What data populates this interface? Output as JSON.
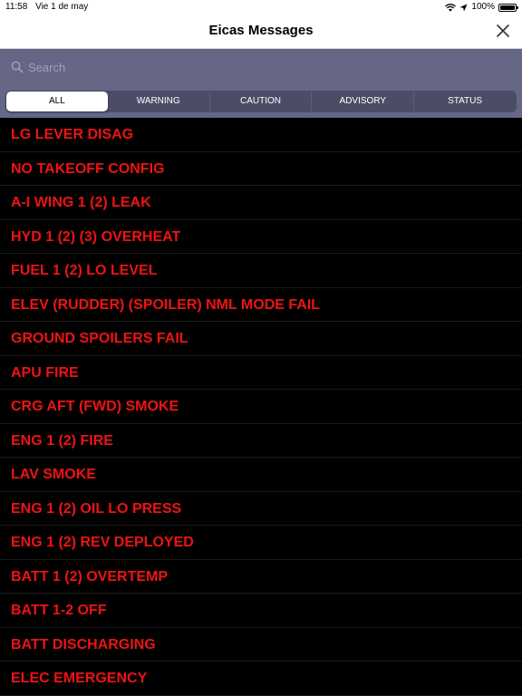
{
  "status_bar": {
    "time": "11:58",
    "date": "Vie 1 de may",
    "battery": "100%"
  },
  "header": {
    "title": "Eicas Messages"
  },
  "search": {
    "placeholder": "Search",
    "value": ""
  },
  "filters": {
    "selected": "ALL",
    "tabs": [
      {
        "label": "ALL"
      },
      {
        "label": "WARNING"
      },
      {
        "label": "CAUTION"
      },
      {
        "label": "ADVISORY"
      },
      {
        "label": "STATUS"
      }
    ]
  },
  "colors": {
    "warning_text": "#ee1313",
    "filter_bar": "#656785",
    "background": "#000000"
  },
  "icons": [
    "wifi-icon",
    "location-icon",
    "battery-icon",
    "close-icon",
    "search-icon"
  ],
  "messages": [
    {
      "text": "LG LEVER DISAG"
    },
    {
      "text": "NO TAKEOFF CONFIG"
    },
    {
      "text": "A-I WING 1 (2) LEAK"
    },
    {
      "text": "HYD 1 (2) (3) OVERHEAT"
    },
    {
      "text": "FUEL 1 (2) LO LEVEL"
    },
    {
      "text": "ELEV (RUDDER) (SPOILER) NML MODE FAIL"
    },
    {
      "text": "GROUND SPOILERS FAIL"
    },
    {
      "text": "APU FIRE"
    },
    {
      "text": "CRG AFT (FWD) SMOKE"
    },
    {
      "text": "ENG 1 (2) FIRE"
    },
    {
      "text": "LAV SMOKE"
    },
    {
      "text": "ENG 1 (2) OIL LO PRESS"
    },
    {
      "text": "ENG 1 (2) REV DEPLOYED"
    },
    {
      "text": "BATT 1 (2) OVERTEMP"
    },
    {
      "text": "BATT 1-2 OFF"
    },
    {
      "text": "BATT DISCHARGING"
    },
    {
      "text": "ELEC EMERGENCY"
    }
  ]
}
